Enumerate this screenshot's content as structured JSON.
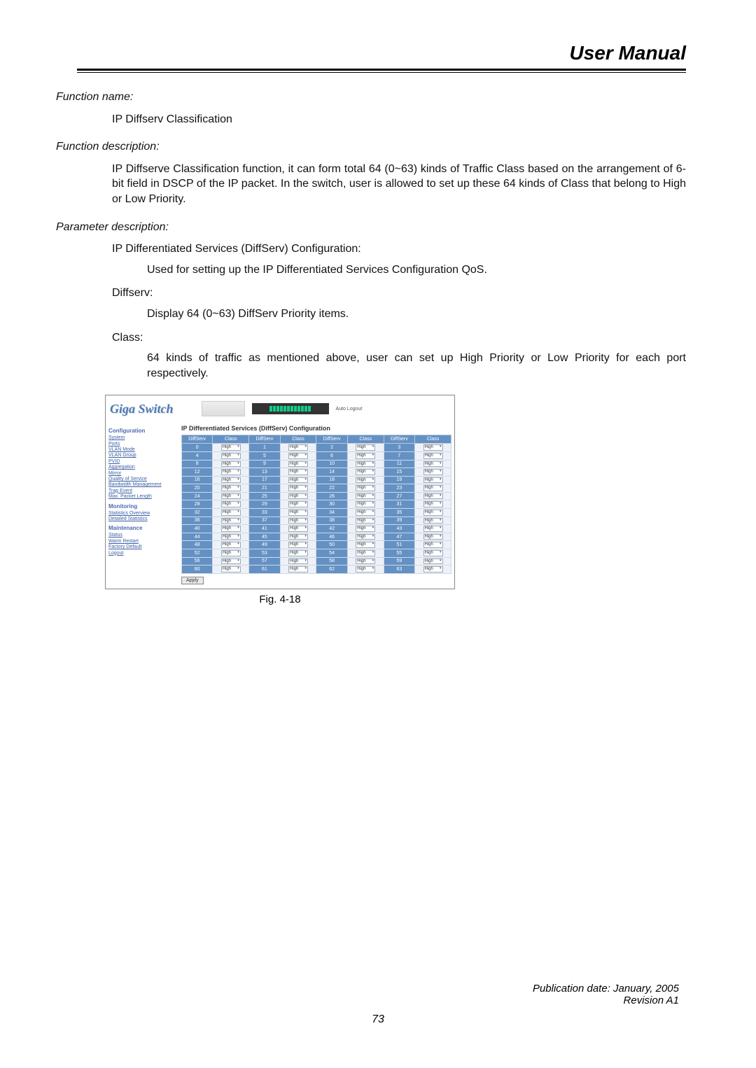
{
  "header": {
    "title": "User Manual"
  },
  "body": {
    "fn_name_label": "Function name:",
    "fn_name": "IP Diffserv Classification",
    "fn_desc_label": "Function description:",
    "fn_desc": "IP Diffserve Classification function, it can form total 64 (0~63) kinds of Traffic Class based on the arrangement of 6-bit field in DSCP of the IP packet.  In the switch, user is allowed to set up these 64 kinds of Class that belong to High or Low Priority.",
    "param_label": "Parameter description:",
    "param_1": "IP Differentiated Services (DiffServ) Configuration:",
    "param_1_desc": "Used for setting up the IP Differentiated Services Configuration QoS.",
    "param_2": "Diffserv:",
    "param_2_desc": "Display 64 (0~63) DiffServ Priority items.",
    "param_3": "Class:",
    "param_3_desc": "64 kinds of traffic as mentioned above, user can set up High Priority or Low Priority for each port respectively."
  },
  "figure": {
    "caption": "Fig. 4-18",
    "logo": "Giga Switch",
    "autologout": "Auto Logout",
    "side_section_config": "Configuration",
    "side_links_config": [
      "System",
      "Ports",
      "VLAN Mode",
      "VLAN Group",
      "PVID",
      "Aggregation",
      "Mirror",
      "Quality of Service",
      "Bandwidth Management",
      "Trap Event",
      "Max. Packet Length"
    ],
    "side_section_monitor": "Monitoring",
    "side_links_monitor": [
      "Statistics Overview",
      "Detailed Statistics"
    ],
    "side_section_maint": "Maintenance",
    "side_links_maint": [
      "Status",
      "Warm Restart",
      "Factory Default",
      "Logout"
    ],
    "main_title": "IP Differentiated Services (DiffServ) Configuration",
    "th_diffserv": "DiffServ",
    "th_class": "Class",
    "class_value": "High",
    "apply": "Apply"
  },
  "chart_data": {
    "type": "table",
    "title": "IP Differentiated Services (DiffServ) Configuration",
    "columns": [
      "DiffServ",
      "Class",
      "DiffServ",
      "Class",
      "DiffServ",
      "Class",
      "DiffServ",
      "Class"
    ],
    "rows": [
      [
        0,
        "High",
        1,
        "High",
        2,
        "High",
        3,
        "High"
      ],
      [
        4,
        "High",
        5,
        "High",
        6,
        "High",
        7,
        "High"
      ],
      [
        8,
        "High",
        9,
        "High",
        10,
        "High",
        11,
        "High"
      ],
      [
        12,
        "High",
        13,
        "High",
        14,
        "High",
        15,
        "High"
      ],
      [
        16,
        "High",
        17,
        "High",
        18,
        "High",
        19,
        "High"
      ],
      [
        20,
        "High",
        21,
        "High",
        22,
        "High",
        23,
        "High"
      ],
      [
        24,
        "High",
        25,
        "High",
        26,
        "High",
        27,
        "High"
      ],
      [
        28,
        "High",
        29,
        "High",
        30,
        "High",
        31,
        "High"
      ],
      [
        32,
        "High",
        33,
        "High",
        34,
        "High",
        35,
        "High"
      ],
      [
        36,
        "High",
        37,
        "High",
        38,
        "High",
        39,
        "High"
      ],
      [
        40,
        "High",
        41,
        "High",
        42,
        "High",
        43,
        "High"
      ],
      [
        44,
        "High",
        45,
        "High",
        46,
        "High",
        47,
        "High"
      ],
      [
        48,
        "High",
        49,
        "High",
        50,
        "High",
        51,
        "High"
      ],
      [
        52,
        "High",
        53,
        "High",
        54,
        "High",
        55,
        "High"
      ],
      [
        56,
        "High",
        57,
        "High",
        58,
        "High",
        59,
        "High"
      ],
      [
        60,
        "High",
        61,
        "High",
        62,
        "High",
        63,
        "High"
      ]
    ]
  },
  "footer": {
    "pub": "Publication date: January, 2005",
    "rev": "Revision A1",
    "page": "73"
  }
}
